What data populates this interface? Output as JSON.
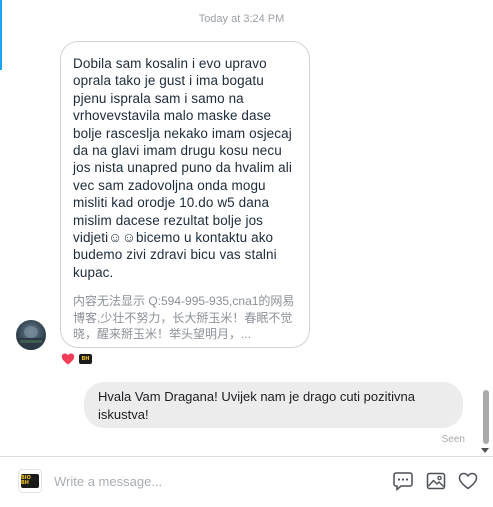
{
  "conversation": {
    "timestamp": "Today at 3:24 PM",
    "incoming_message": {
      "text": "Dobila sam kosalin i evo upravo oprala tako je gust i ima bogatu pjenu isprala sam i samo na vrhovevstavila malo maske dase bolje rasceslja nekako imam osjecaj da na glavi imam drugu kosu necu jos nista unapred puno da hvalim ali vec sam zadovoljna onda mogu misliti kad orodje 10.do w5 dana mislim dacese rezultat bolje jos vidjeti☺☺bicemo u kontaktu ako budemo zivi zdravi bicu vas stalni kupac.",
      "preview_text": "内容无法显示 Q:594-995-935,cna1的网易博客,少壮不努力，长大掰玉米！春眠不觉晓，醒来掰玉米！举头望明月，..."
    },
    "reactions": [
      "heart-icon",
      "page-logo"
    ],
    "outgoing_message": {
      "text": "Hvala Vam Dragana! Uvijek nam je drago cuti pozitivna iskustva!"
    },
    "status": "Seen"
  },
  "composer": {
    "placeholder": "Write a message...",
    "logo_text": "BIO BH"
  },
  "colors": {
    "accent": "#1da1f2",
    "heart": "#f23d58",
    "outgoing_bubble": "#ececed",
    "incoming_border": "#d0d3d7"
  }
}
